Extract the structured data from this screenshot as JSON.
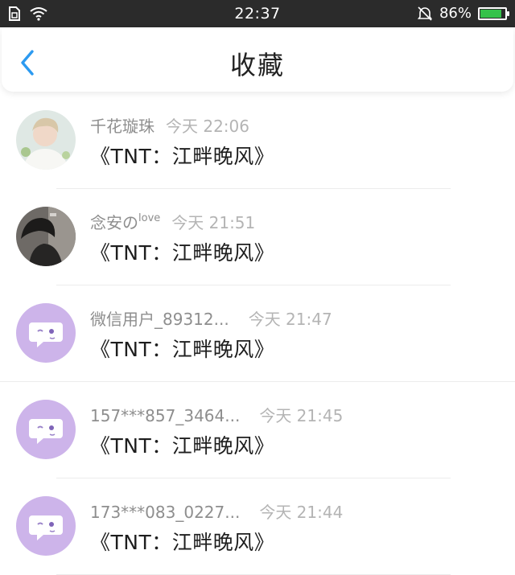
{
  "status_bar": {
    "time": "22:37",
    "battery_percent": "86%",
    "battery_level": 0.86,
    "icons": [
      "sim-icon",
      "wifi-icon",
      "alarm-off-icon",
      "battery-charging-icon"
    ]
  },
  "header": {
    "title": "收藏",
    "back_icon": "chevron-left-icon",
    "accent": "#2c9af0"
  },
  "items": [
    {
      "name": "千花璇珠",
      "name_suffix": "",
      "time": "今天 22:06",
      "title": "《TNT：江畔晚风》",
      "avatar": "photo-portrait"
    },
    {
      "name": "念安の",
      "name_suffix": "love",
      "time": "今天 21:51",
      "title": "《TNT：江畔晚风》",
      "avatar": "photo-dark"
    },
    {
      "name": "微信用户_89312...",
      "name_suffix": "",
      "time": "今天 21:47",
      "title": "《TNT：江畔晚风》",
      "avatar": "default-chat-avatar"
    },
    {
      "name": "157***857_3464...",
      "name_suffix": "",
      "time": "今天 21:45",
      "title": "《TNT：江畔晚风》",
      "avatar": "default-chat-avatar"
    },
    {
      "name": "173***083_0227...",
      "name_suffix": "",
      "time": "今天 21:44",
      "title": "《TNT：江畔晚风》",
      "avatar": "default-chat-avatar"
    }
  ],
  "colors": {
    "avatar_default": "#cdb4ea",
    "name_text": "#8e8e8e",
    "time_text": "#b4b4b4",
    "title_text": "#1e1e1e",
    "battery_charging": "#35c24a"
  }
}
